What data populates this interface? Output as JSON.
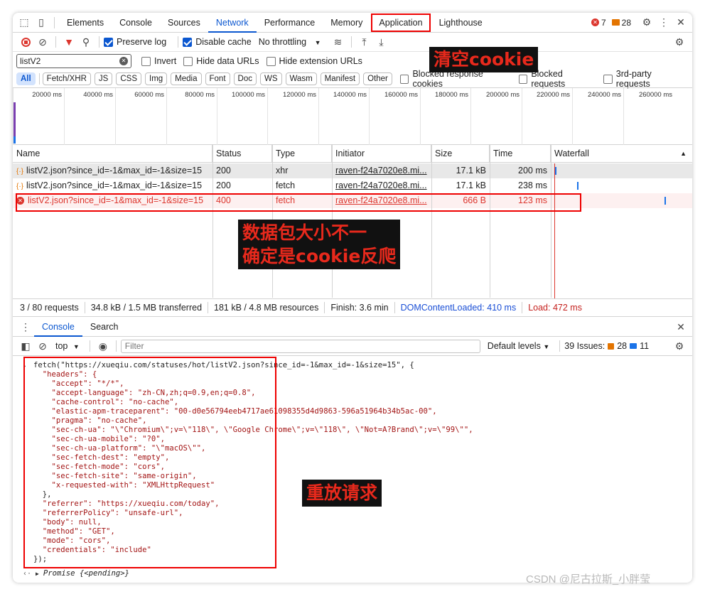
{
  "tabs": [
    "Elements",
    "Console",
    "Sources",
    "Network",
    "Performance",
    "Memory",
    "Application",
    "Lighthouse"
  ],
  "badges": {
    "errors": "7",
    "warnings": "28"
  },
  "toolbar": {
    "preserve_log": "Preserve log",
    "disable_cache": "Disable cache",
    "throttling": "No throttling"
  },
  "filter": {
    "value": "listV2",
    "invert": "Invert",
    "hide_data_urls": "Hide data URLs",
    "hide_ext_urls": "Hide extension URLs"
  },
  "types": [
    "All",
    "Fetch/XHR",
    "JS",
    "CSS",
    "Img",
    "Media",
    "Font",
    "Doc",
    "WS",
    "Wasm",
    "Manifest",
    "Other"
  ],
  "type_checks": {
    "blocked_cookies": "Blocked response cookies",
    "blocked_requests": "Blocked requests",
    "third_party": "3rd-party requests"
  },
  "overview_ticks": [
    "20000 ms",
    "40000 ms",
    "60000 ms",
    "80000 ms",
    "100000 ms",
    "120000 ms",
    "140000 ms",
    "160000 ms",
    "180000 ms",
    "200000 ms",
    "220000 ms",
    "240000 ms",
    "260000 ms"
  ],
  "columns": [
    "Name",
    "Status",
    "Type",
    "Initiator",
    "Size",
    "Time",
    "Waterfall"
  ],
  "requests": [
    {
      "name": "listV2.json?since_id=-1&max_id=-1&size=15",
      "status": "200",
      "type": "xhr",
      "initiator": "raven-f24a7020e8.mi...",
      "size": "17.1 kB",
      "time": "200 ms"
    },
    {
      "name": "listV2.json?since_id=-1&max_id=-1&size=15",
      "status": "200",
      "type": "fetch",
      "initiator": "raven-f24a7020e8.mi...",
      "size": "17.1 kB",
      "time": "238 ms"
    },
    {
      "name": "listV2.json?since_id=-1&max_id=-1&size=15",
      "status": "400",
      "type": "fetch",
      "initiator": "raven-f24a7020e8.mi...",
      "size": "666 B",
      "time": "123 ms"
    }
  ],
  "status_bar": {
    "requests": "3 / 80 requests",
    "transferred": "34.8 kB / 1.5 MB transferred",
    "resources": "181 kB / 4.8 MB resources",
    "finish": "Finish: 3.6 min",
    "dcl": "DOMContentLoaded: 410 ms",
    "load": "Load: 472 ms"
  },
  "drawer": {
    "console_tab": "Console",
    "search_tab": "Search"
  },
  "console_toolbar": {
    "context": "top",
    "filter_placeholder": "Filter",
    "levels": "Default levels",
    "issues": "39 Issues:",
    "issues_warn": "28",
    "issues_info": "11"
  },
  "console_lines": [
    "fetch(\"https://xueqiu.com/statuses/hot/listV2.json?since_id=-1&max_id=-1&size=15\", {",
    "  \"headers\": {",
    "    \"accept\": \"*/*\",",
    "    \"accept-language\": \"zh-CN,zh;q=0.9,en;q=0.8\",",
    "    \"cache-control\": \"no-cache\",",
    "    \"elastic-apm-traceparent\": \"00-d0e56794eeb4717ae61098355d4d9863-596a51964b34b5ac-00\",",
    "    \"pragma\": \"no-cache\",",
    "    \"sec-ch-ua\": \"\\\"Chromium\\\";v=\\\"118\\\", \\\"Google Chrome\\\";v=\\\"118\\\", \\\"Not=A?Brand\\\";v=\\\"99\\\"\",",
    "    \"sec-ch-ua-mobile\": \"?0\",",
    "    \"sec-ch-ua-platform\": \"\\\"macOS\\\"\",",
    "    \"sec-fetch-dest\": \"empty\",",
    "    \"sec-fetch-mode\": \"cors\",",
    "    \"sec-fetch-site\": \"same-origin\",",
    "    \"x-requested-with\": \"XMLHttpRequest\"",
    "  },",
    "  \"referrer\": \"https://xueqiu.com/today\",",
    "  \"referrerPolicy\": \"unsafe-url\",",
    "  \"body\": null,",
    "  \"method\": \"GET\",",
    "  \"mode\": \"cors\",",
    "  \"credentials\": \"include\"",
    "});"
  ],
  "console_result": "Promise {<pending>}",
  "annotations": {
    "clear_cookie": "清空cookie",
    "size_diff_1": "数据包大小不一",
    "size_diff_2": "确定是cookie反爬",
    "replay": "重放请求"
  },
  "watermark": "CSDN @尼古拉斯_小胖莹"
}
